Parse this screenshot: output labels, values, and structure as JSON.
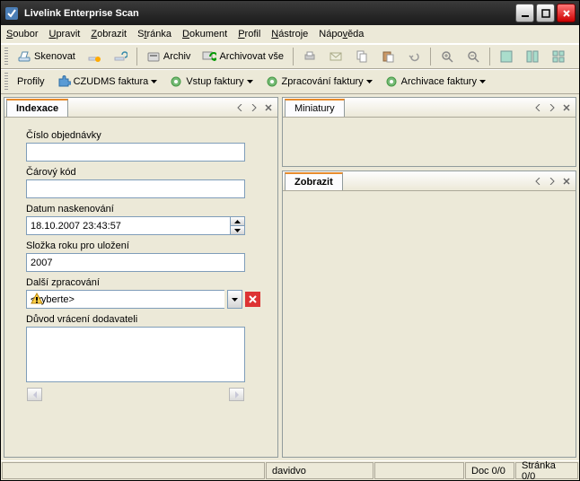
{
  "window": {
    "title": "Livelink Enterprise Scan"
  },
  "menu": {
    "soubor": "Soubor",
    "upravit": "Upravit",
    "zobrazit": "Zobrazit",
    "stranka": "Stránka",
    "dokument": "Dokument",
    "profil": "Profil",
    "nastroje": "Nástroje",
    "napoveda": "Nápověda"
  },
  "toolbar1": {
    "skenovat": "Skenovat",
    "archiv": "Archiv",
    "archivovat_vse": "Archivovat vše"
  },
  "toolbar2": {
    "profily": "Profily",
    "czudms": "CZUDMS faktura",
    "vstup": "Vstup faktury",
    "zpracovani": "Zpracování faktury",
    "archivace": "Archivace faktury"
  },
  "indexace": {
    "tab": "Indexace",
    "cislo_label": "Číslo objednávky",
    "cislo_value": "",
    "carovy_label": "Čárový kód",
    "carovy_value": "",
    "datum_label": "Datum naskenování",
    "datum_value": "18.10.2007 23:43:57",
    "slozka_label": "Složka roku pro uložení",
    "slozka_value": "2007",
    "dalsi_label": "Další zpracování",
    "dalsi_value": "<vyberte>",
    "duvod_label": "Důvod vrácení dodavateli",
    "duvod_value": ""
  },
  "miniatury": {
    "tab": "Miniatury"
  },
  "zobrazit": {
    "tab": "Zobrazit"
  },
  "status": {
    "user": "davidvo",
    "doc": "Doc 0/0",
    "page": "Stránka 0/0"
  }
}
